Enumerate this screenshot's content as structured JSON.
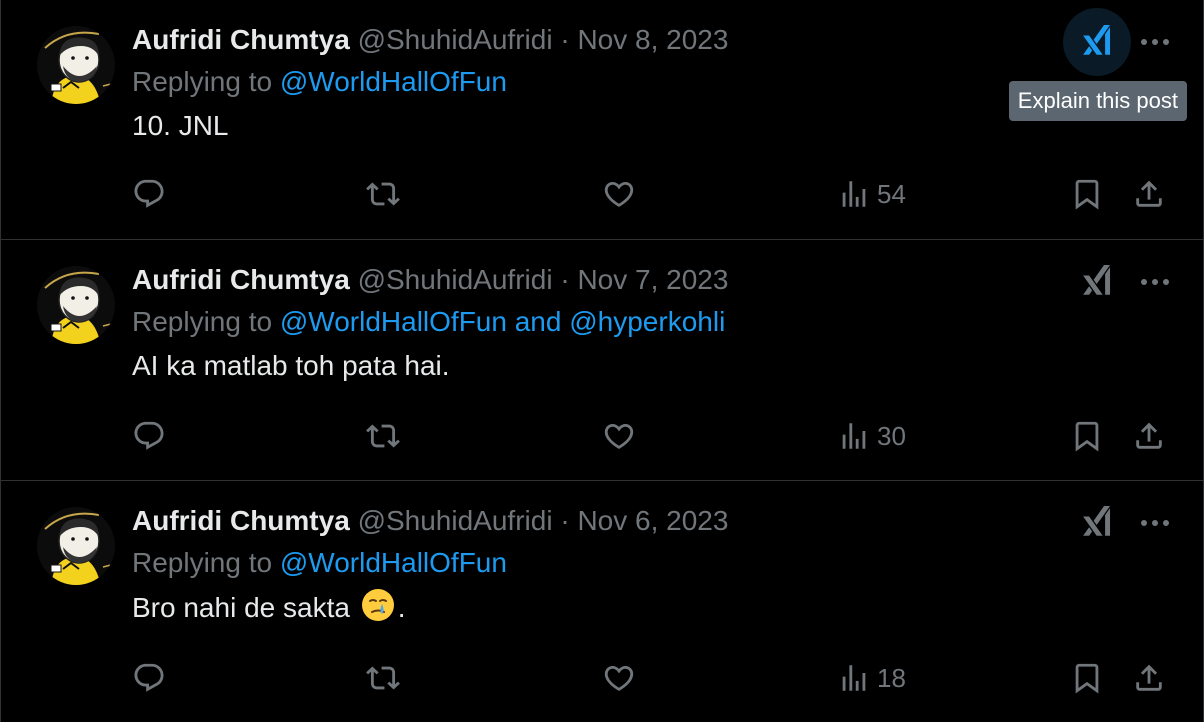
{
  "tooltip": "Explain this post",
  "posts": [
    {
      "name": "Aufridi Chumtya",
      "handle": "@ShuhidAufridi",
      "separator": "·",
      "date": "Nov 8, 2023",
      "replying_prefix": "Replying to",
      "mention1": "@WorldHallOfFun",
      "mention_joiner": "",
      "mention2": "",
      "text": "10. JNL",
      "views": "54"
    },
    {
      "name": "Aufridi Chumtya",
      "handle": "@ShuhidAufridi",
      "separator": "·",
      "date": "Nov 7, 2023",
      "replying_prefix": "Replying to",
      "mention1": "@WorldHallOfFun",
      "mention_joiner": "and",
      "mention2": "@hyperkohli",
      "text": "AI ka matlab toh pata hai.",
      "views": "30"
    },
    {
      "name": "Aufridi Chumtya",
      "handle": "@ShuhidAufridi",
      "separator": "·",
      "date": "Nov 6, 2023",
      "replying_prefix": "Replying to",
      "mention1": "@WorldHallOfFun",
      "mention_joiner": "",
      "mention2": "",
      "text": "Bro nahi de sakta",
      "text_suffix": ".",
      "views": "18"
    }
  ],
  "icons": {
    "reply": "reply-icon",
    "repost": "repost-icon",
    "like": "heart-icon",
    "views": "views-chart-icon",
    "bookmark": "bookmark-icon",
    "share": "share-icon",
    "grok": "grok-icon",
    "more": "more-icon",
    "emoji": "face-holding-back-tears-emoji"
  },
  "colors": {
    "background": "#000000",
    "accent": "#1d9bf0",
    "muted": "#71767b",
    "text": "#e7e9ea",
    "border": "#2f3336",
    "tooltip_bg": "#5b6670"
  }
}
